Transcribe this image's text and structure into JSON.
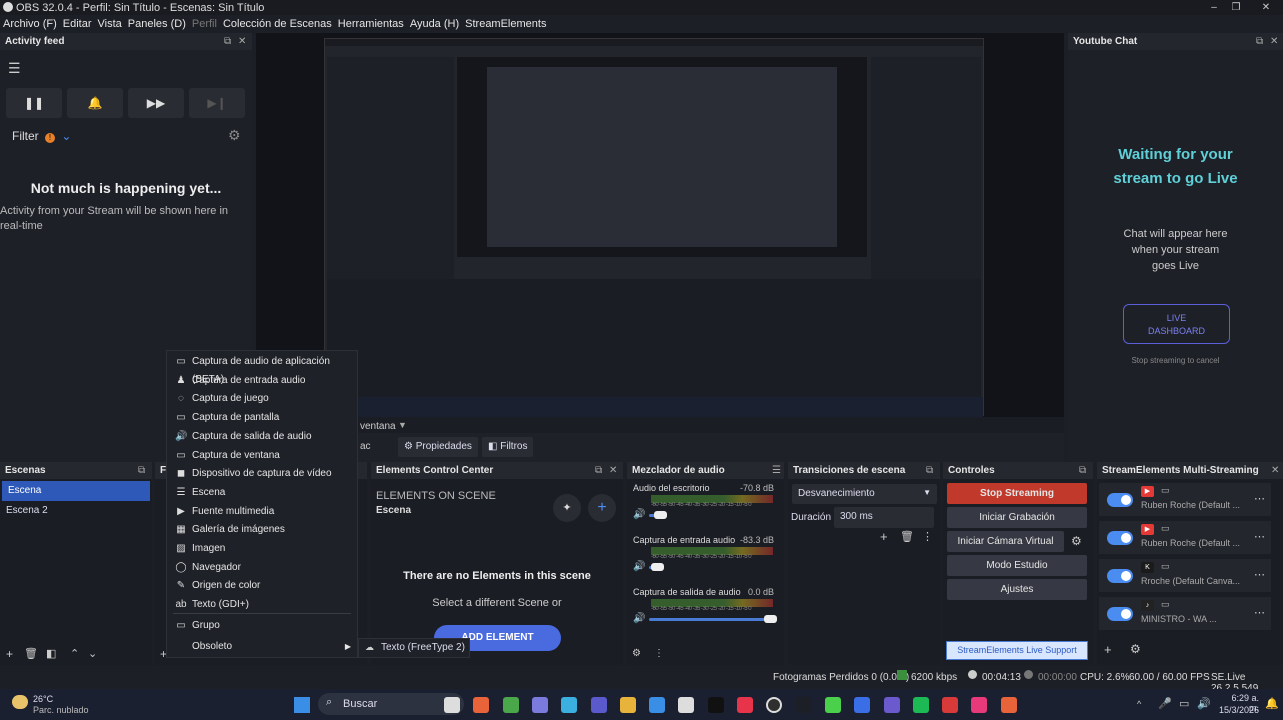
{
  "window": {
    "title": "OBS 32.0.4 - Perfil: Sin Título - Escenas: Sin Título",
    "min": "–",
    "max": "❐",
    "close": "✕"
  },
  "menu": [
    "Archivo (F)",
    "Editar",
    "Vista",
    "Paneles (D)",
    "Perfil",
    "Colección de Escenas",
    "Herramientas",
    "Ayuda (H)",
    "StreamElements"
  ],
  "activity": {
    "title": "Activity feed",
    "filter": "Filter",
    "filter_badge": "!",
    "empty_title": "Not much is happening yet...",
    "empty_text": "Activity from your Stream will be shown here in real-time"
  },
  "yt": {
    "title": "Youtube Chat",
    "waiting": "Waiting for your stream to go Live",
    "chat_text": "Chat will appear here when your stream goes Live",
    "live_btn": "LIVE DASHBOARD",
    "stop_text": "Stop streaming to cancel"
  },
  "preview": {
    "props": "Propiedades",
    "filters": "Filtros",
    "source_label": "ventana",
    "source_prefix": "ac"
  },
  "scenes": {
    "title": "Escenas",
    "items": [
      "Escena",
      "Escena 2"
    ]
  },
  "sources_title": "Fu",
  "ecc": {
    "title": "Elements Control Center",
    "on_scene": "ELEMENTS ON SCENE",
    "scene": "Escena",
    "no_elements": "There are no Elements in this scene",
    "select": "Select a different Scene or",
    "add": "ADD ELEMENT"
  },
  "mixer": {
    "title": "Mezclador de audio",
    "channels": [
      {
        "name": "Audio del escritorio",
        "db": "-70.8 dB",
        "level": 0.1
      },
      {
        "name": "Captura de entrada audio",
        "db": "-83.3 dB",
        "level": 0.07
      },
      {
        "name": "Captura de salida de audio",
        "db": "0.0 dB",
        "level": 1
      }
    ],
    "ticks": "-60 -55 -50 -45 -40 -35 -30 -25 -20 -15 -10 -5 0"
  },
  "transitions": {
    "title": "Transiciones de escena",
    "selected": "Desvanecimiento",
    "duration_label": "Duración",
    "duration": "300 ms"
  },
  "controls": {
    "title": "Controles",
    "buttons": [
      "Stop Streaming",
      "Iniciar Grabación",
      "Iniciar Cámara Virtual",
      "Modo Estudio",
      "Ajustes"
    ]
  },
  "multistream": {
    "title": "StreamElements Multi-Streaming",
    "items": [
      "Ruben Roche (Default ...",
      "Ruben Roche (Default ...",
      "Rroche (Default Canva...",
      "MINISTRO - WA ..."
    ],
    "support": "StreamElements Live Support"
  },
  "context_menu": [
    "Captura de audio de aplicación (BETA)",
    "Captura de entrada audio",
    "Captura de juego",
    "Captura de pantalla",
    "Captura de salida de audio",
    "Captura de ventana",
    "Dispositivo de captura de vídeo",
    "Escena",
    "Fuente multimedia",
    "Galería de imágenes",
    "Imagen",
    "Navegador",
    "Origen de color",
    "Texto (GDI+)",
    "Grupo",
    "Obsoleto"
  ],
  "submenu": "Texto (FreeType 2)",
  "status": {
    "dropped": "Fotogramas Perdidos 0 (0.0%)",
    "bitrate": "6200 kbps",
    "stream_time": "00:04:13",
    "rec_time": "00:00:00",
    "cpu": "CPU: 2.6%",
    "fps": "60.00 / 60.00 FPS",
    "version": "SE.Live 26.2.5.549"
  },
  "taskbar": {
    "temp": "26°C",
    "weather": "Parc. nublado",
    "search": "Buscar",
    "time": "6:29 a. m.",
    "date": "15/3/2026"
  }
}
